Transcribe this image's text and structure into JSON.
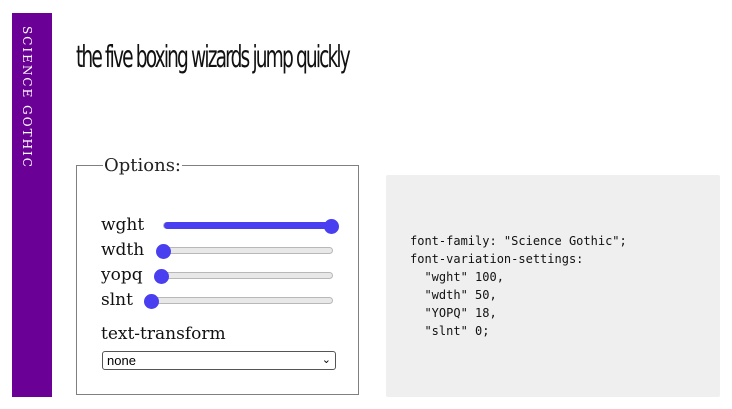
{
  "sidebar": {
    "title": "SCIENCE GOTHIC"
  },
  "sample_text": "the five boxing wizards jump quickly",
  "options": {
    "legend": "Options:",
    "axes": [
      {
        "label": "wght",
        "value": 100,
        "min": 100,
        "max": 900,
        "fraction": 1.0
      },
      {
        "label": "wdth",
        "value": 50,
        "min": 50,
        "max": 200,
        "fraction": 0.0
      },
      {
        "label": "yopq",
        "value": 18,
        "min": 18,
        "max": 300,
        "fraction": 0.0
      },
      {
        "label": "slnt",
        "value": 0,
        "min": 0,
        "max": -30,
        "fraction": 0.0
      }
    ],
    "text_transform_label": "text-transform",
    "text_transform_value": "none"
  },
  "code": {
    "line1": "font-family: \"Science Gothic\";",
    "line2": "font-variation-settings:",
    "line3": "  \"wght\" 100,",
    "line4": "  \"wdth\" 50,",
    "line5": "  \"YOPQ\" 18,",
    "line6": "  \"slnt\" 0;"
  },
  "colors": {
    "sidebar": "#6a0096",
    "slider_accent": "#4a3ff0",
    "code_background": "#efefef"
  }
}
